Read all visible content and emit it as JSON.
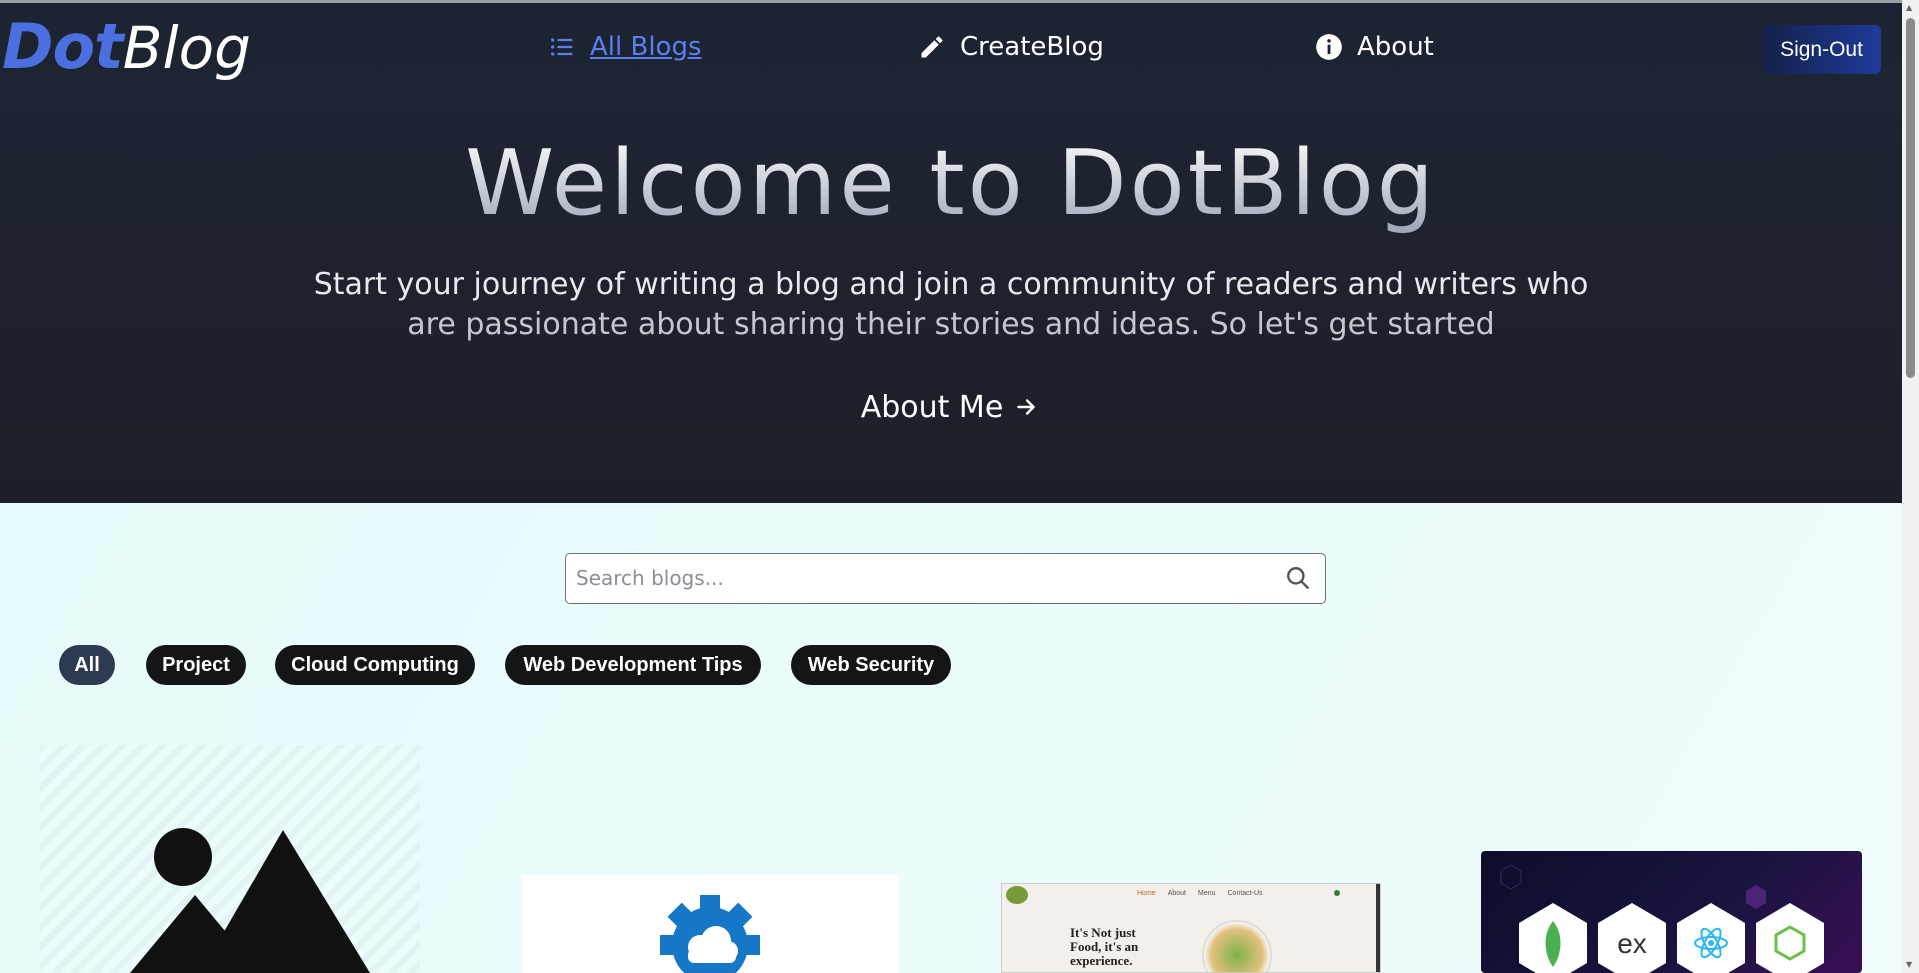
{
  "logo": {
    "part1": "Dot",
    "part2": "Blog"
  },
  "nav": {
    "items": [
      {
        "label": "All Blogs",
        "icon": "list-icon",
        "active": true
      },
      {
        "label": "CreateBlog",
        "icon": "pencil-icon",
        "active": false
      },
      {
        "label": "About",
        "icon": "info-icon",
        "active": false
      }
    ],
    "signout_label": "Sign-Out"
  },
  "hero": {
    "title": "Welcome to DotBlog",
    "subtitle_line1": "Start your journey of writing a blog and join a community of readers and writers who",
    "subtitle_line2": "are passionate about sharing their stories and ideas. So let's get started",
    "cta_label": "About Me"
  },
  "search": {
    "placeholder": "Search blogs...",
    "value": ""
  },
  "tags": [
    "All",
    "Project",
    "Cloud Computing",
    "Web Development Tips",
    "Web Security"
  ],
  "active_tag": "All",
  "cards": [
    {
      "kind": "placeholder-image"
    },
    {
      "kind": "cloud-gear-image"
    },
    {
      "kind": "food-site-screenshot",
      "headline": "It's Not just Food, it's an experience.",
      "menu": [
        "Home",
        "About",
        "Menu",
        "Contact-Us"
      ]
    },
    {
      "kind": "mern-stack-image",
      "labels": [
        "ex"
      ]
    }
  ],
  "colors": {
    "accent": "#4c6fe0",
    "hero_bg": "#1c2230",
    "main_bg": "#ecfbfb",
    "tag_bg": "#141517",
    "tag_active_bg": "#2c3a52"
  }
}
